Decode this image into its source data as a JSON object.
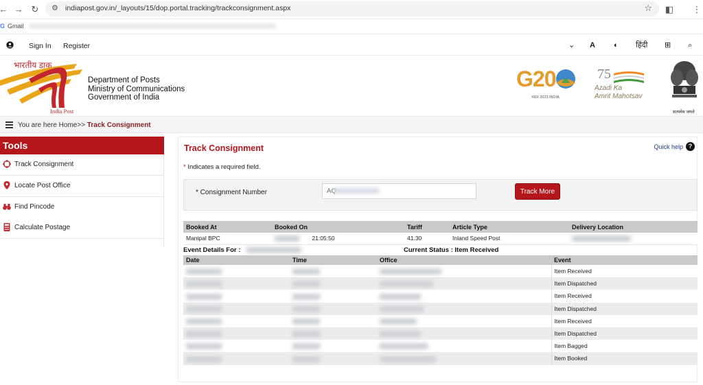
{
  "browser": {
    "url": "indiapost.gov.in/_layouts/15/dop.portal.tracking/trackconsignment.aspx",
    "bookmark": "Gmail"
  },
  "topbar": {
    "sign_in": "Sign In",
    "register": "Register",
    "hindi_link": "हिंदी"
  },
  "header": {
    "brand_hindi": "भारतीय डाक",
    "brand_en": "India Post",
    "dept_line1": "Department of Posts",
    "dept_line2": "Ministry of Communications",
    "dept_line3": "Government of India",
    "g20_mark": "G20",
    "g20_sub": "भारत 2023 INDIA",
    "azadi_num": "75",
    "azadi_line1": "Azadi Ka",
    "azadi_line2": "Amrit Mahotsav",
    "emblem_motto": "सत्यमेव जयते"
  },
  "breadcrumb": {
    "prefix": "You are here Home>>",
    "current": "Track Consignment"
  },
  "sidebar": {
    "title": "Tools",
    "items": [
      {
        "label": "Track Consignment",
        "icon": "crosshair-icon"
      },
      {
        "label": "Locate Post Office",
        "icon": "map-pin-icon"
      },
      {
        "label": "Find Pincode",
        "icon": "binoculars-icon"
      },
      {
        "label": "Calculate Postage",
        "icon": "calculator-icon"
      }
    ]
  },
  "main": {
    "title": "Track Consignment",
    "quick_help": "Quick help",
    "required_note": "Indicates a required field.",
    "consignment_label": "* Consignment Number",
    "consignment_value": "AQ",
    "track_button": "Track More",
    "summary": {
      "headers": [
        "Booked At",
        "Booked On",
        "Tariff",
        "Article Type",
        "Delivery Location"
      ],
      "row": {
        "booked_at": "Manipal BPC",
        "booked_on_time": "21:05:50",
        "tariff": "41.30",
        "article_type": "Inland Speed Post"
      }
    },
    "event_details_for": "Event Details For :",
    "current_status": "Current Status : Item Received",
    "events": {
      "headers": [
        "Date",
        "Time",
        "Office",
        "Event"
      ],
      "rows": [
        {
          "event": "Item Received"
        },
        {
          "event": "Item Dispatched"
        },
        {
          "event": "Item Received"
        },
        {
          "event": "Item Dispatched"
        },
        {
          "event": "Item Received"
        },
        {
          "event": "Item Dispatched"
        },
        {
          "event": "Item Bagged"
        },
        {
          "event": "Item Booked"
        }
      ]
    }
  },
  "colors": {
    "brand_red": "#b5161c",
    "header_grey": "#c9c9c9"
  }
}
